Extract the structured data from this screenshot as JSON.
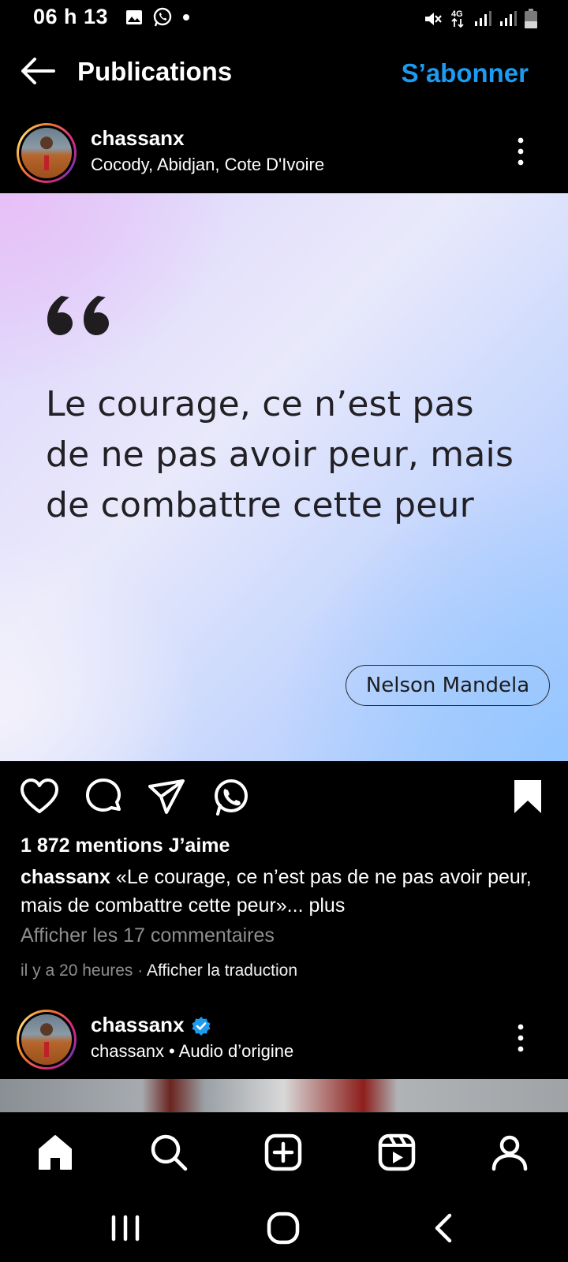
{
  "status_bar": {
    "time": "06 h 13",
    "icons": [
      "gallery-icon",
      "whatsapp-icon",
      "dot-icon"
    ],
    "right_icons": [
      "mute-icon",
      "4g-icon",
      "signal-icon",
      "signal-icon",
      "battery-icon"
    ],
    "network_label": "4G"
  },
  "header": {
    "title": "Publications",
    "subscribe_label": "S’abonner",
    "accent_color": "#1d9bf0"
  },
  "post": {
    "username": "chassanx",
    "location": "Cocody, Abidjan, Cote D'Ivoire",
    "quote": "Le courage, ce n’est pas de ne pas avoir peur, mais de combattre cette peur",
    "author": "Nelson Mandela",
    "likes": "1 872 mentions J’aime",
    "caption_username": "chassanx",
    "caption_text": "«Le courage, ce n’est pas de ne pas avoir peur, mais de combattre cette peur»...",
    "caption_more": "plus",
    "comments_link": "Afficher les 17 commentaires",
    "time_ago": "il y a 20 heures",
    "separator": "·",
    "translate_label": "Afficher la traduction"
  },
  "post2": {
    "username": "chassanx",
    "subtitle": "chassanx • Audio d’origine",
    "verified": true
  },
  "bottom_nav": [
    "home-icon",
    "search-icon",
    "create-icon",
    "reels-icon",
    "profile-icon"
  ],
  "system_nav": [
    "recents-icon",
    "home-circle-icon",
    "back-icon"
  ]
}
